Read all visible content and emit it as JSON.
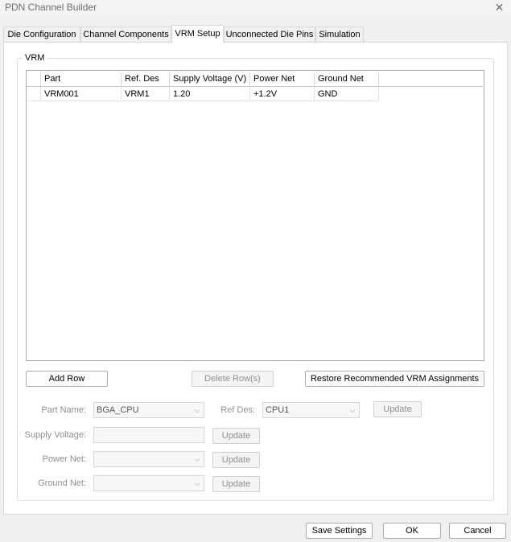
{
  "window": {
    "title": "PDN Channel Builder",
    "close_glyph": "✕"
  },
  "tabs": [
    {
      "label": "Die Configuration"
    },
    {
      "label": "Channel Components"
    },
    {
      "label": "VRM Setup"
    },
    {
      "label": "Unconnected Die Pins"
    },
    {
      "label": "Simulation"
    }
  ],
  "active_tab": "VRM Setup",
  "vrm_group": {
    "title": "VRM",
    "columns": [
      "Part",
      "Ref. Des",
      "Supply Voltage (V)",
      "Power Net",
      "Ground Net"
    ],
    "rows": [
      [
        "VRM001",
        "VRM1",
        "1.20",
        "+1.2V",
        "GND"
      ]
    ]
  },
  "actions": {
    "add_row": "Add Row",
    "delete_rows": "Delete Row(s)",
    "restore": "Restore Recommended VRM Assignments"
  },
  "form": {
    "part_name_label": "Part Name:",
    "part_name_value": "BGA_CPU",
    "ref_des_label": "Ref Des:",
    "ref_des_value": "CPU1",
    "supply_voltage_label": "Supply Voltage:",
    "supply_voltage_value": "",
    "power_net_label": "Power Net:",
    "power_net_value": "",
    "ground_net_label": "Ground Net:",
    "ground_net_value": "",
    "update_label": "Update",
    "dropdown_glyph": "⌵"
  },
  "footer": {
    "save_settings": "Save Settings",
    "ok": "OK",
    "cancel": "Cancel"
  }
}
